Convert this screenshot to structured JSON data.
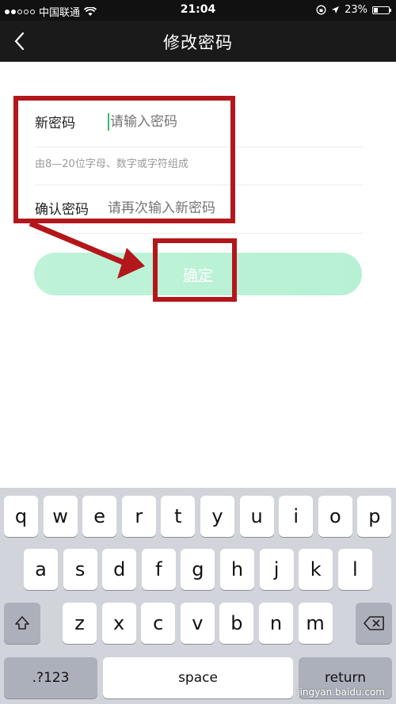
{
  "status_bar": {
    "carrier": "中国联通",
    "time": "21:04",
    "battery": "23%"
  },
  "nav": {
    "title": "修改密码"
  },
  "form": {
    "new_label": "新密码",
    "new_placeholder": "请输入密码",
    "hint": "由8—20位字母、数字或字符组成",
    "confirm_label": "确认密码",
    "confirm_placeholder": "请再次输入新密码"
  },
  "confirm_button": "确定",
  "colors": {
    "annotation": "#b3171b",
    "button": "#bff2d8",
    "cursor": "#2fbf6a"
  },
  "keyboard": {
    "row1": [
      "q",
      "w",
      "e",
      "r",
      "t",
      "y",
      "u",
      "i",
      "o",
      "p"
    ],
    "row2": [
      "a",
      "s",
      "d",
      "f",
      "g",
      "h",
      "j",
      "k",
      "l"
    ],
    "row3": [
      "z",
      "x",
      "c",
      "v",
      "b",
      "n",
      "m"
    ],
    "numbers_key": ".?123",
    "space_key": "space",
    "return_key": "return"
  },
  "watermark": "jingyan.baidu.com"
}
